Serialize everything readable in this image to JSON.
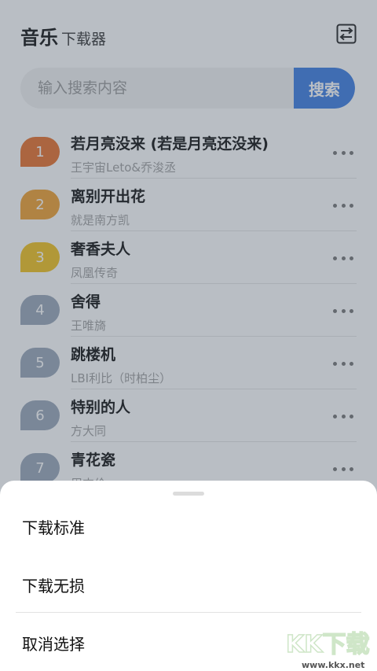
{
  "header": {
    "title": "音乐",
    "subtitle": "下载器"
  },
  "search": {
    "placeholder": "输入搜索内容",
    "button_label": "搜索"
  },
  "songs": [
    {
      "rank": "1",
      "title": "若月亮没来 (若是月亮还没来)",
      "artist": "王宇宙Leto&乔浚丞",
      "badge_color": "#e8702a"
    },
    {
      "rank": "2",
      "title": "离别开出花",
      "artist": "就是南方凯",
      "badge_color": "#f0a030"
    },
    {
      "rank": "3",
      "title": "奢香夫人",
      "artist": "凤凰传奇",
      "badge_color": "#f2c21e"
    },
    {
      "rank": "4",
      "title": "舍得",
      "artist": "王唯旖",
      "badge_color": "#9aa6b8"
    },
    {
      "rank": "5",
      "title": "跳楼机",
      "artist": "LBI利比（时柏尘）",
      "badge_color": "#9aa6b8"
    },
    {
      "rank": "6",
      "title": "特别的人",
      "artist": "方大同",
      "badge_color": "#9aa6b8"
    },
    {
      "rank": "7",
      "title": "青花瓷",
      "artist": "周杰伦",
      "badge_color": "#9aa6b8"
    }
  ],
  "sheet": {
    "option_standard": "下载标准",
    "option_lossless": "下载无损",
    "option_cancel": "取消选择"
  },
  "watermark": {
    "text": "KK下载",
    "url": "www.kkx.net"
  },
  "colors": {
    "accent": "#3d7de2",
    "overlay": "rgba(70,85,100,0.38)"
  }
}
